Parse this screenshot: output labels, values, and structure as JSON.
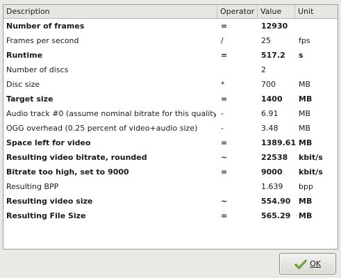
{
  "table": {
    "columns": [
      "Description",
      "Operator",
      "Value",
      "Unit"
    ],
    "rows": [
      {
        "description": "Number of frames",
        "operator": "=",
        "value": "12930",
        "unit": "",
        "bold": true
      },
      {
        "description": "Frames per second",
        "operator": "/",
        "value": "25",
        "unit": "fps",
        "bold": false
      },
      {
        "description": "Runtime",
        "operator": "=",
        "value": "517.2",
        "unit": "s",
        "bold": true
      },
      {
        "description": "Number of discs",
        "operator": "",
        "value": "2",
        "unit": "",
        "bold": false
      },
      {
        "description": "Disc size",
        "operator": "*",
        "value": "700",
        "unit": "MB",
        "bold": false
      },
      {
        "description": "Target size",
        "operator": "=",
        "value": "1400",
        "unit": "MB",
        "bold": true
      },
      {
        "description": "Audio track #0 (assume nominal bitrate for this quality)",
        "operator": "-",
        "value": "6.91",
        "unit": "MB",
        "bold": false
      },
      {
        "description": "OGG overhead (0.25 percent of video+audio size)",
        "operator": "-",
        "value": "3.48",
        "unit": "MB",
        "bold": false
      },
      {
        "description": "Space left for video",
        "operator": "=",
        "value": "1389.61",
        "unit": "MB",
        "bold": true
      },
      {
        "description": "Resulting video bitrate, rounded",
        "operator": "~",
        "value": "22538",
        "unit": "kbit/s",
        "bold": true
      },
      {
        "description": "Bitrate too high, set to 9000",
        "operator": "=",
        "value": "9000",
        "unit": "kbit/s",
        "bold": true
      },
      {
        "description": "Resulting BPP",
        "operator": "",
        "value": "1.639",
        "unit": "bpp",
        "bold": false
      },
      {
        "description": "Resulting video size",
        "operator": "~",
        "value": "554.90",
        "unit": "MB",
        "bold": true
      },
      {
        "description": "Resulting File Size",
        "operator": "=",
        "value": "565.29",
        "unit": "MB",
        "bold": true
      }
    ]
  },
  "ok_button": {
    "label": "OK",
    "icon": "checkmark-icon"
  }
}
